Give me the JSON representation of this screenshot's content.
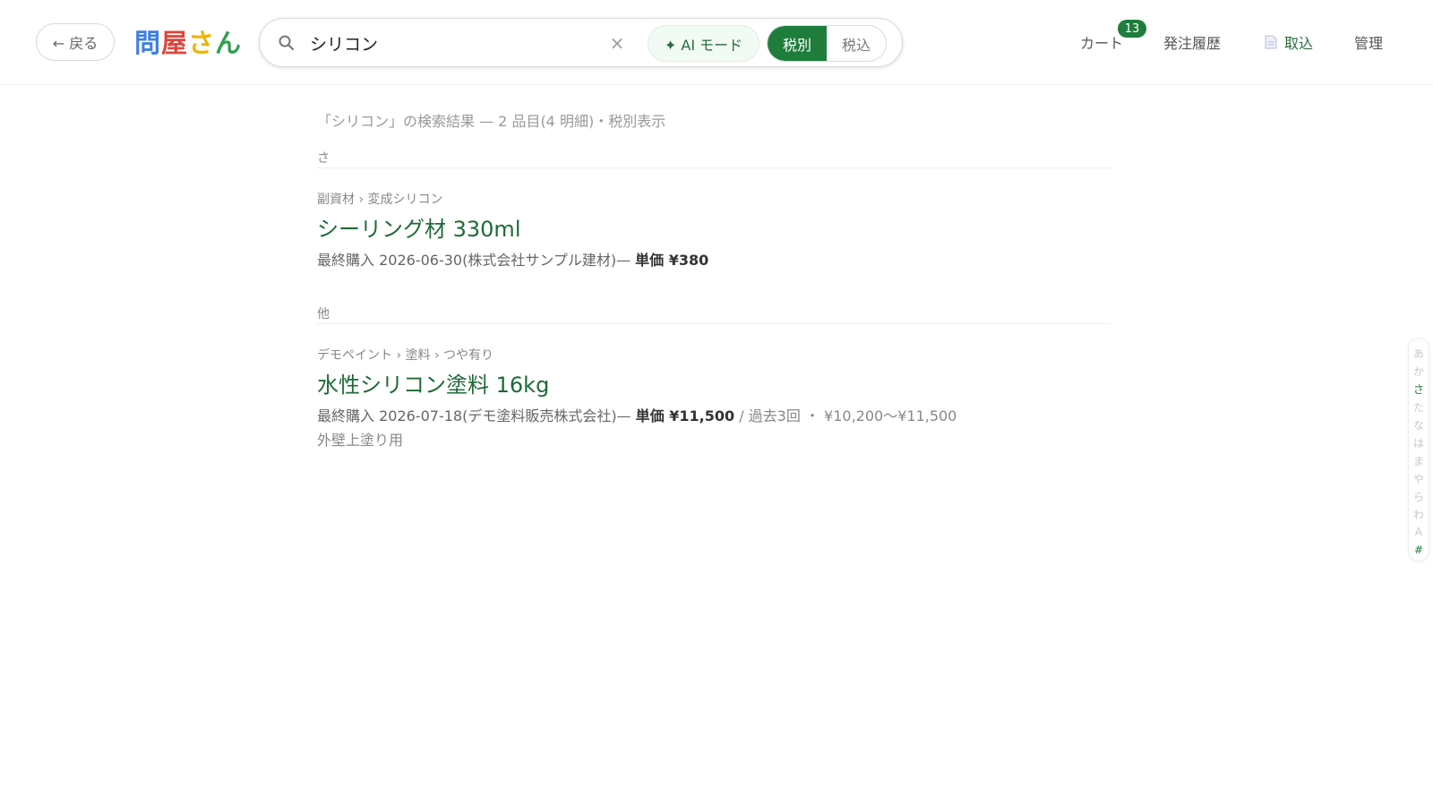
{
  "header": {
    "back_label": "← 戻る",
    "logo": [
      {
        "char": "問",
        "color": "#3f7fe0"
      },
      {
        "char": "屋",
        "color": "#e0453a"
      },
      {
        "char": "さ",
        "color": "#f0b400"
      },
      {
        "char": "ん",
        "color": "#2ea04f"
      }
    ],
    "search": {
      "value": "シリコン",
      "placeholder": "",
      "clear_label": "×",
      "ai_label": "✦ AI モード",
      "tax_options": [
        {
          "label": "税別",
          "active": true
        },
        {
          "label": "税込",
          "active": false
        }
      ]
    },
    "nav": {
      "cart_label": "カート",
      "cart_count": "13",
      "history_label": "発注履歴",
      "import_label": "取込",
      "admin_label": "管理"
    }
  },
  "results": {
    "summary": "「シリコン」の検索結果 — 2 品目(4 明細)・税別表示",
    "sections": [
      {
        "heading": "さ",
        "items": [
          {
            "crumb": "副資材 › 変成シリコン",
            "title": "シーリング材 330ml",
            "meta_prefix": "最終購入 2026-06-30(株式会社サンプル建材)— ",
            "price": "単価 ¥380",
            "history": "",
            "note": ""
          }
        ]
      },
      {
        "heading": "他",
        "items": [
          {
            "crumb": "デモペイント › 塗料 › つや有り",
            "title": "水性シリコン塗料 16kg",
            "meta_prefix": "最終購入 2026-07-18(デモ塗料販売株式会社)— ",
            "price": "単価 ¥11,500",
            "history": " / 過去3回 ・ ¥10,200〜¥11,500",
            "note": "外壁上塗り用"
          }
        ]
      }
    ]
  },
  "index_bar": {
    "letters": [
      "あ",
      "か",
      "さ",
      "た",
      "な",
      "は",
      "ま",
      "や",
      "ら",
      "わ",
      "A",
      "#"
    ],
    "active": [
      "さ",
      "#"
    ]
  },
  "colors": {
    "accent": "#1e7d3c",
    "title_green": "#1e6b36"
  }
}
